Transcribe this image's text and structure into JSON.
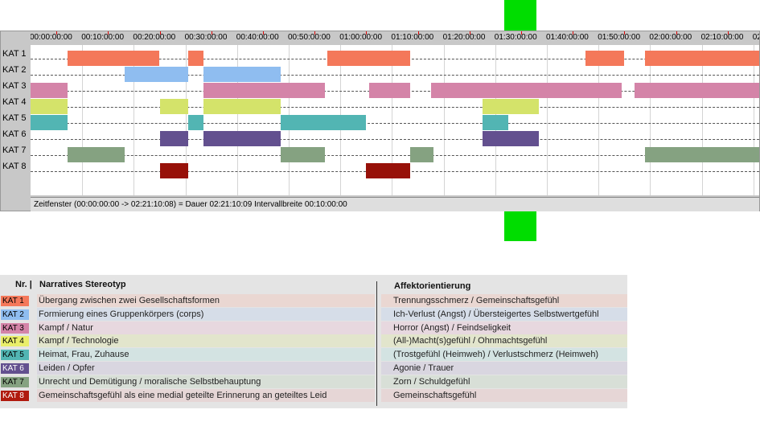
{
  "timeline": {
    "ticks": [
      "00:00:00:00",
      "00:10:00:00",
      "00:20:00:00",
      "00:30:00:00",
      "00:40:00:00",
      "00:50:00:00",
      "01:00:00:00",
      "01:10:00:00",
      "01:20:00:00",
      "01:30:00:00",
      "01:40:00:00",
      "01:50:00:00",
      "02:00:00:00",
      "02:10:00:00",
      "02"
    ],
    "rows": [
      {
        "label": "KAT 1",
        "color": "#f4785a",
        "segments": [
          [
            7.2,
            25.0
          ],
          [
            30.5,
            33.5
          ],
          [
            57.5,
            73.5
          ],
          [
            107.5,
            115.0
          ],
          [
            119.0,
            141.2
          ]
        ]
      },
      {
        "label": "KAT 2",
        "color": "#8fbdf0",
        "segments": [
          [
            18.2,
            30.5
          ],
          [
            33.5,
            48.5
          ]
        ]
      },
      {
        "label": "KAT 3",
        "color": "#d484a8",
        "segments": [
          [
            0,
            7.2
          ],
          [
            33.5,
            57.0
          ],
          [
            65.5,
            73.5
          ],
          [
            77.5,
            114.5
          ],
          [
            117.0,
            141.2
          ]
        ]
      },
      {
        "label": "KAT 4",
        "color": "#d4e36a",
        "segments": [
          [
            0,
            7.2
          ],
          [
            25.0,
            30.5
          ],
          [
            33.5,
            48.5
          ],
          [
            87.5,
            98.5
          ]
        ]
      },
      {
        "label": "KAT 5",
        "color": "#52b5b3",
        "segments": [
          [
            0,
            7.2
          ],
          [
            30.5,
            33.5
          ],
          [
            48.5,
            65.0
          ],
          [
            87.5,
            92.5
          ]
        ]
      },
      {
        "label": "KAT 6",
        "color": "#63508f",
        "segments": [
          [
            25.0,
            30.5
          ],
          [
            33.5,
            48.5
          ],
          [
            87.5,
            98.5
          ]
        ]
      },
      {
        "label": "KAT 7",
        "color": "#85a281",
        "segments": [
          [
            7.2,
            18.2
          ],
          [
            48.5,
            57.0
          ],
          [
            73.5,
            78.0
          ],
          [
            119.0,
            141.2
          ]
        ]
      },
      {
        "label": "KAT 8",
        "color": "#971109",
        "segments": [
          [
            25.0,
            30.5
          ],
          [
            65.0,
            73.5
          ]
        ]
      }
    ],
    "status": "Zeitfenster (00:00:00:00 -> 02:21:10:08) = Dauer 02:21:10:09    Intervallbreite 00:10:00:00"
  },
  "legend": {
    "headers": {
      "nr": "Nr. |",
      "stereotyp": "Narratives Stereotyp",
      "affekt": "Affektorientierung"
    },
    "rows": [
      {
        "nr": "KAT 1",
        "color": "#f4785a",
        "bg": "#ead7d2",
        "stereotyp": "Übergang zwischen zwei Gesellschaftsformen",
        "affekt": "Trennungsschmerz / Gemeinschaftsgefühl"
      },
      {
        "nr": "KAT 2",
        "color": "#8fbdf0",
        "bg": "#d6dde8",
        "stereotyp": "Formierung eines Gruppenkörpers (corps)",
        "affekt": "Ich-Verlust (Angst) / Übersteigertes Selbstwertgefühl"
      },
      {
        "nr": "KAT 3",
        "color": "#d484a8",
        "bg": "#e7d8df",
        "stereotyp": "Kampf / Natur",
        "affekt": "Horror (Angst) / Feindseligkeit"
      },
      {
        "nr": "KAT 4",
        "color": "#e9ee6a",
        "bg": "#e2e5cc",
        "stereotyp": "Kampf / Technologie",
        "affekt": "(All-)Macht(s)gefühl / Ohnmachtsgefühl"
      },
      {
        "nr": "KAT 5",
        "color": "#52b5b3",
        "bg": "#d3e3e2",
        "stereotyp": "Heimat, Frau, Zuhause",
        "affekt": "(Trostgefühl (Heimweh) / Verlustschmerz (Heimweh)"
      },
      {
        "nr": "KAT 6",
        "color": "#63508f",
        "bg": "#d9d6e0",
        "stereotyp": "Leiden / Opfer",
        "affekt": "Agonie / Trauer"
      },
      {
        "nr": "KAT 7",
        "color": "#85a281",
        "bg": "#d8dfd7",
        "stereotyp": "Unrecht und Demütigung / moralische Selbstbehauptung",
        "affekt": "Zorn / Schuldgefühl"
      },
      {
        "nr": "KAT 8",
        "color": "#b01a0e",
        "bg": "#e6d6d6",
        "stereotyp": "Gemeinschaftsgefühl als eine medial geteilte Erinnerung an geteiltes Leid",
        "affekt": "Gemeinschaftsgefühl"
      }
    ]
  }
}
